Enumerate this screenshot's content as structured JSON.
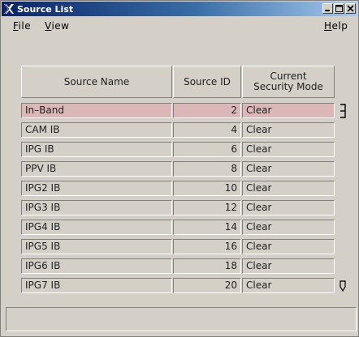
{
  "window": {
    "title": "Source List",
    "icon": "x-logo-icon",
    "controls": [
      "minimize-icon",
      "maximize-icon",
      "close-icon"
    ],
    "title_gradient": [
      "#0a246a",
      "#a6caf0"
    ]
  },
  "menu": {
    "file": {
      "mnemonic": "F",
      "rest": "ile"
    },
    "view": {
      "mnemonic": "V",
      "rest": "iew"
    },
    "help": {
      "mnemonic": "H",
      "rest": "elp"
    }
  },
  "table": {
    "columns": {
      "name": "Source Name",
      "id": "Source ID",
      "mode_line1": "Current",
      "mode_line2": "Security Mode"
    },
    "rows": [
      {
        "name": "In–Band",
        "id": "2",
        "mode": "Clear",
        "selected": true
      },
      {
        "name": "CAM IB",
        "id": "4",
        "mode": "Clear"
      },
      {
        "name": "IPG IB",
        "id": "6",
        "mode": "Clear"
      },
      {
        "name": "PPV IB",
        "id": "8",
        "mode": "Clear"
      },
      {
        "name": "IPG2 IB",
        "id": "10",
        "mode": "Clear"
      },
      {
        "name": "IPG3 IB",
        "id": "12",
        "mode": "Clear"
      },
      {
        "name": "IPG4 IB",
        "id": "14",
        "mode": "Clear"
      },
      {
        "name": "IPG5 IB",
        "id": "16",
        "mode": "Clear"
      },
      {
        "name": "IPG6 IB",
        "id": "18",
        "mode": "Clear"
      },
      {
        "name": "IPG7 IB",
        "id": "20",
        "mode": "Clear"
      }
    ],
    "selected_color": "#dbb7b7"
  },
  "status": {
    "text": ""
  }
}
